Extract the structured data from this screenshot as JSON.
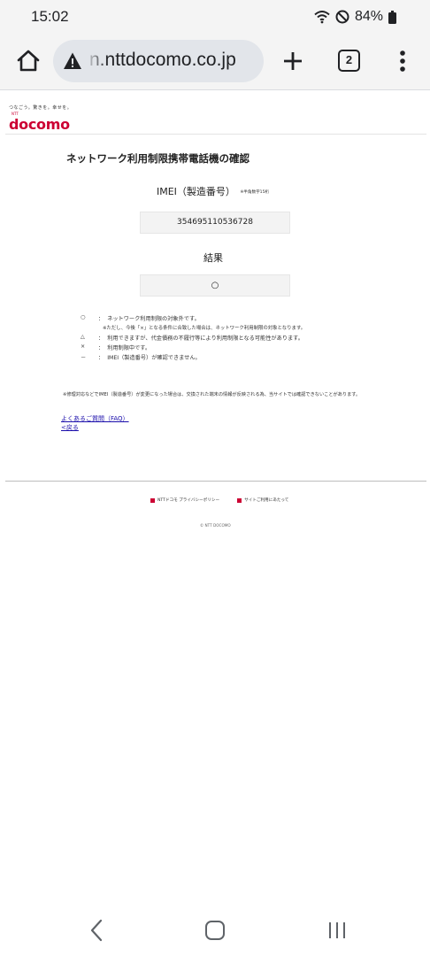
{
  "status_bar": {
    "time": "15:02",
    "battery": "84%",
    "icons": [
      "wifi-icon",
      "do-not-disturb-icon",
      "battery-icon"
    ]
  },
  "browser": {
    "url": "n.nttdocomo.co.jp",
    "tab_count": "2",
    "icons": [
      "home-icon",
      "warning-icon",
      "plus-icon",
      "tabs-icon",
      "more-vert-icon"
    ]
  },
  "page": {
    "tagline": "つなごう。驚きを。幸せを。",
    "logo_ntt": "NTT",
    "logo": "docomo",
    "title": "ネットワーク利用制限携帯電話機の確認",
    "imei_label": "IMEI（製造番号）",
    "imei_note": "※半角数字15桁",
    "imei_value": "354695110536728",
    "result_label": "結果",
    "result_value": "○",
    "legend": [
      {
        "symbol": "○",
        "sep": "：",
        "text": "ネットワーク利用制限の対象外です。"
      },
      {
        "symbol": "",
        "sep": "",
        "text": "※ただし、今後「×」となる条件に合致した場合は、ネットワーク利用制限の対象となります。"
      },
      {
        "symbol": "△",
        "sep": "：",
        "text": "利用できますが、代金債務の不履行等により利用制限となる可能性があります。"
      },
      {
        "symbol": "×",
        "sep": "：",
        "text": "利用制限中です。"
      },
      {
        "symbol": "－",
        "sep": "：",
        "text": "IMEI（製造番号）が確認できません。"
      }
    ],
    "notice": "※修理対応などでIMEI（製造番号）が変更になった場合は、交換された端末の情報が反映される為、当サイトでは確認できないことがあります。",
    "faq_link": "よくあるご質問（FAQ）",
    "back_link": "<戻る",
    "footer_links": [
      "NTTドコモ プライバシーポリシー",
      "サイトご利用にあたって"
    ],
    "copyright": "© NTT DOCOMO"
  },
  "colors": {
    "brand": "#cc0033",
    "link": "#1a0dab",
    "toolbar_bg": "#f4f4f4",
    "url_pill_bg": "#e2e5ea"
  }
}
